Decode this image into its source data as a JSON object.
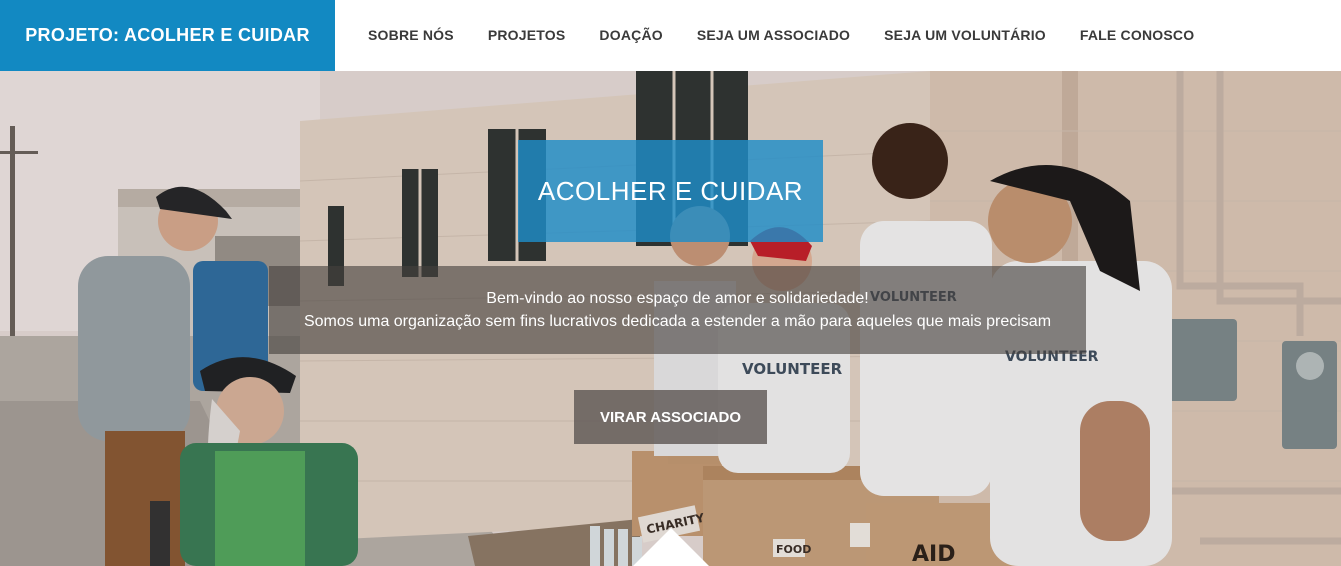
{
  "nav": {
    "brand": "PROJETO: ACOLHER E CUIDAR",
    "items": [
      {
        "label": "SOBRE NÓS"
      },
      {
        "label": "PROJETOS"
      },
      {
        "label": "DOAÇÃO"
      },
      {
        "label": "SEJA UM ASSOCIADO"
      },
      {
        "label": "SEJA UM VOLUNTÁRIO"
      },
      {
        "label": "FALE CONOSCO"
      }
    ]
  },
  "hero": {
    "title": "ACOLHER E CUIDAR",
    "subtitle_line1": "Bem-vindo ao nosso espaço de amor e solidariedade!",
    "subtitle_line2": "Somos uma organização sem fins lucrativos dedicada a estender a mão para aqueles que mais precisam",
    "cta_label": "VIRAR ASSOCIADO",
    "photo_text": {
      "shirt": "VOLUNTEER",
      "box_charity": "CHARITY",
      "box_food": "FOOD",
      "box_aid": "AID"
    }
  },
  "colors": {
    "brand": "#1289c2",
    "nav_text": "#3a3a3a",
    "title_box": "#1e8cc8",
    "overlay": "#46413e"
  },
  "icons": {
    "scroll_down": "triangle-up-icon"
  }
}
